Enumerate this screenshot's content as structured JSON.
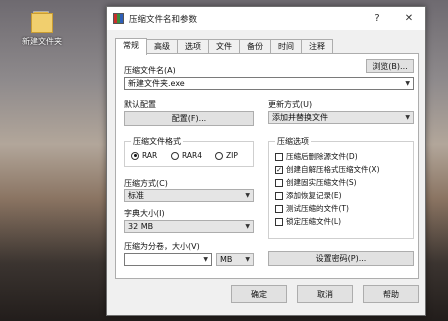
{
  "desktop": {
    "folder_label": "新建文件夹"
  },
  "window": {
    "title": "压缩文件名和参数",
    "help": "?",
    "close": "✕"
  },
  "tabs": [
    "常规",
    "高级",
    "选项",
    "文件",
    "备份",
    "时间",
    "注释"
  ],
  "general": {
    "archive_name_label": "压缩文件名(A)",
    "browse": "浏览(B)...",
    "archive_name_value": "新建文件夹.exe",
    "default_profile_label": "默认配置",
    "profiles_button": "配置(F)...",
    "update_mode_label": "更新方式(U)",
    "update_mode_value": "添加并替换文件",
    "format_group": "压缩文件格式",
    "formats": [
      "RAR",
      "RAR4",
      "ZIP"
    ],
    "method_label": "压缩方式(C)",
    "method_value": "标准",
    "dict_label": "字典大小(I)",
    "dict_value": "32 MB",
    "split_label": "压缩为分卷，大小(V)",
    "split_value": "",
    "split_unit": "MB",
    "options_group": "压缩选项",
    "options": [
      {
        "label": "压缩后删除源文件(D)",
        "checked": false
      },
      {
        "label": "创建自解压格式压缩文件(X)",
        "checked": true
      },
      {
        "label": "创建固实压缩文件(S)",
        "checked": false
      },
      {
        "label": "添加恢复记录(E)",
        "checked": false
      },
      {
        "label": "测试压缩的文件(T)",
        "checked": false
      },
      {
        "label": "锁定压缩文件(L)",
        "checked": false
      }
    ],
    "password_button": "设置密码(P)..."
  },
  "buttons": {
    "ok": "确定",
    "cancel": "取消",
    "help": "帮助"
  }
}
